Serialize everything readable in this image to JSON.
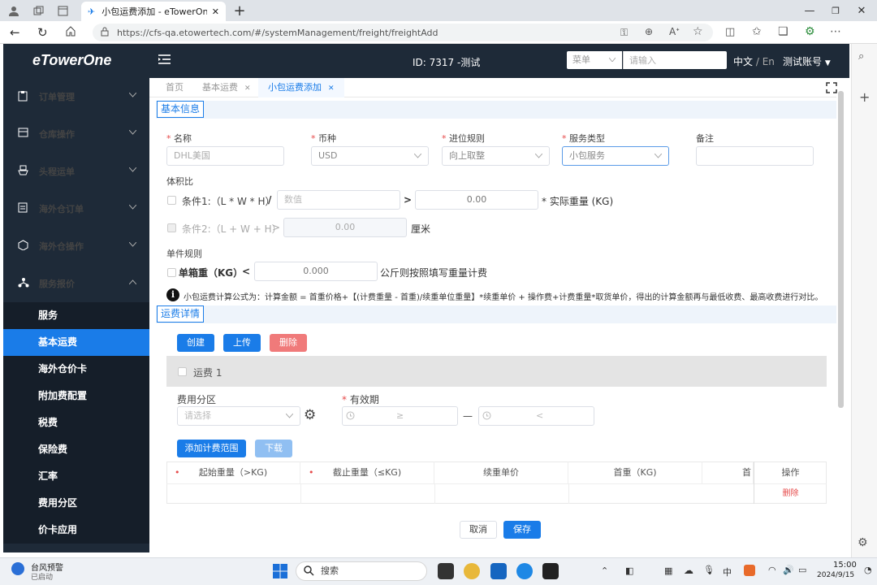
{
  "browser": {
    "tab_title": "小包运费添加 - eTowerOne",
    "url": "https://cfs-qa.etowertech.com/#/systemManagement/freight/freightAdd"
  },
  "header": {
    "logo": "eTowerOne",
    "id_title": "ID: 7317 -测试",
    "menu_select": "菜单",
    "search_placeholder": "请输入",
    "lang_zh": "中文",
    "lang_sep": " / ",
    "lang_en": "En",
    "account": "测试账号"
  },
  "sidebar": {
    "items": [
      {
        "label": "订单管理"
      },
      {
        "label": "仓库操作"
      },
      {
        "label": "头程运单"
      },
      {
        "label": "海外仓订单"
      },
      {
        "label": "海外仓操作"
      },
      {
        "label": "服务报价"
      }
    ],
    "sub_items": [
      {
        "label": "服务"
      },
      {
        "label": "基本运费"
      },
      {
        "label": "海外仓价卡"
      },
      {
        "label": "附加费配置"
      },
      {
        "label": "税费"
      },
      {
        "label": "保险费"
      },
      {
        "label": "汇率"
      },
      {
        "label": "费用分区"
      },
      {
        "label": "价卡应用"
      }
    ]
  },
  "page_tabs": [
    {
      "label": "首页"
    },
    {
      "label": "基本运费"
    },
    {
      "label": "小包运费添加"
    }
  ],
  "basic": {
    "section_title": "基本信息",
    "name_label": "名称",
    "name_value": "DHL美国",
    "currency_label": "币种",
    "currency_value": "USD",
    "rounding_label": "进位规则",
    "rounding_value": "向上取整",
    "service_label": "服务类型",
    "service_value": "小包服务",
    "remark_label": "备注",
    "vol_label": "体积比",
    "cond1_label": "条件1:（L * W * H）",
    "slash": "/",
    "cond1_placeholder": "数值",
    "gt": ">",
    "cond1_value": "0.00",
    "cond1_suffix": "* 实际重量 (KG)",
    "cond2_label": "条件2:（L + W + H）",
    "cond2_gt": ">",
    "cond2_value": "0.00",
    "cond2_unit": "厘米",
    "piece_label": "单件规则",
    "piece_text": "单箱重（KG）",
    "lt": "<",
    "piece_value": "0.000",
    "piece_suffix": "公斤则按照填写重量计费",
    "info_icon": "i",
    "formula": "小包运费计算公式为：计算金额 = 首重价格+【(计费重量 - 首重)/续重单位重量】*续重单价 + 操作费+计费重量*取货单价，得出的计算金额再与最低收费、最高收费进行对比。"
  },
  "detail": {
    "section_title": "运费详情",
    "create": "创建",
    "upload": "上传",
    "delete": "删除",
    "fee_name": "运费 1",
    "zone_label": "费用分区",
    "zone_placeholder": "请选择",
    "validity_label": "有效期",
    "start_symbol": "≥",
    "dash": "—",
    "end_symbol": "<",
    "add_range": "添加计费范围",
    "download": "下载",
    "columns": [
      "起始重量（>KG)",
      "截止重量（≤KG)",
      "续重单价",
      "首重（KG)",
      "首",
      "操作"
    ],
    "row_delete": "删除",
    "required_mark": "•",
    "cancel": "取消",
    "save": "保存"
  },
  "taskbar": {
    "weather_title": "台风预警",
    "weather_sub": "已启动",
    "search": "搜索",
    "ime": "中",
    "time": "15:00",
    "date": "2024/9/15"
  },
  "colors": {
    "brand_dark": "#1e2a38",
    "accent": "#1a7ce8",
    "danger": "#f07a7a"
  }
}
